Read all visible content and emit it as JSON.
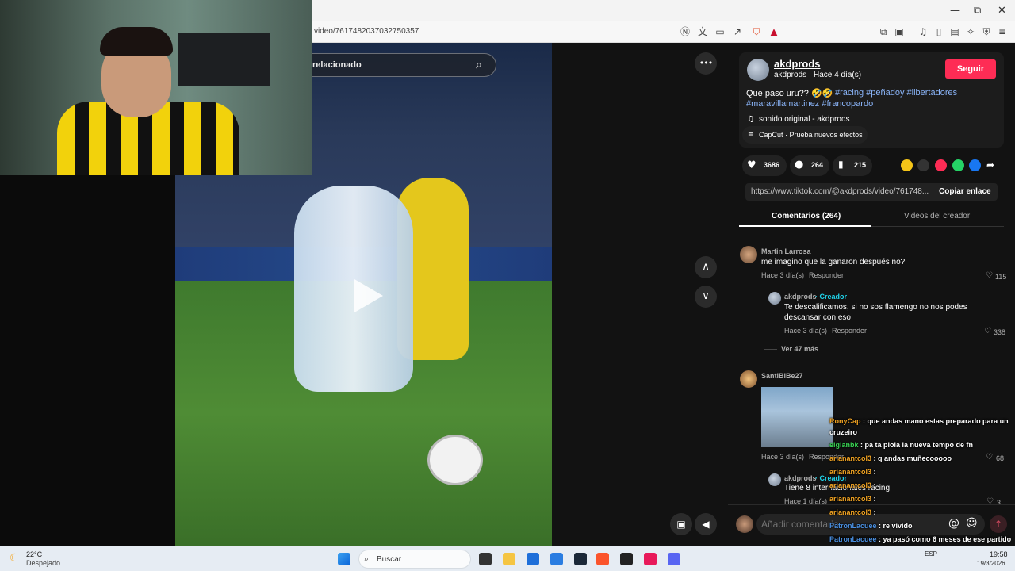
{
  "browser": {
    "url": "video/7617482037032750357",
    "window_controls": {
      "minimize": "—",
      "restore": "⧉",
      "close": "✕"
    }
  },
  "video": {
    "search_text": "relacionado",
    "more_icon": "•••"
  },
  "author": {
    "name": "akdprods",
    "meta": "akdprods · Hace 4 día(s)",
    "follow_label": "Seguir",
    "caption": "Que paso uru?? 🤣🤣",
    "hashtags_line1": "#racing #peñadoy #libertadores",
    "hashtags_line2": "#maravillamartinez #francopardo",
    "sound": "sonido original - akdprods",
    "capcut": "CapCut · Prueba nuevos efectos"
  },
  "stats": {
    "likes": "3686",
    "comments": "264",
    "saves": "215"
  },
  "share": {
    "link": "https://www.tiktok.com/@akdprods/video/761748...",
    "copy_label": "Copiar enlace"
  },
  "tabs": {
    "comments": "Comentarios (264)",
    "creator_videos": "Videos del creador"
  },
  "comments": [
    {
      "user": "Martin Larrosa",
      "text": "me imagino que la ganaron después no?",
      "time": "Hace 3 día(s)",
      "reply": "Responder",
      "likes": "115"
    },
    {
      "user": "akdprods",
      "creator_tag": "· Creador",
      "text_line1": "Te descalificamos, si no sos flamengo no nos podes",
      "text_line2": "descansar con eso",
      "time": "Hace 3 día(s)",
      "reply": "Responder",
      "likes": "338"
    },
    {
      "view_more": "Ver 47 más"
    },
    {
      "user": "SantiBiBe27",
      "time": "Hace 3 día(s)",
      "reply": "Responder",
      "likes": "68"
    },
    {
      "user": "akdprods",
      "creator_tag": "· Creador",
      "text": "Tiene 8 internacionales racing",
      "time": "Hace 1 día(s)",
      "likes": "3"
    }
  ],
  "chat_overlay": [
    {
      "user": "RonyCap",
      "text": ": que andas mano estas preparado para un",
      "user_color": "#f5a623"
    },
    {
      "user": "",
      "text": "cruzeiro",
      "user_color": "#ffffff"
    },
    {
      "user": "elgianbk",
      "text": ": pa ta piola la nueva tempo de fn",
      "user_color": "#39d353"
    },
    {
      "user": "arianantcol3",
      "text": ": q andas muñecooooo",
      "user_color": "#f5a623"
    },
    {
      "user": "arianantcol3",
      "text": ":",
      "user_color": "#f5a623"
    },
    {
      "user": "arianantcol3",
      "text": ":",
      "user_color": "#f5a623"
    },
    {
      "user": "arianantcol3",
      "text": ":",
      "user_color": "#f5a623"
    },
    {
      "user": "arianantcol3",
      "text": ":",
      "user_color": "#f5a623"
    },
    {
      "user": "PatronLacuee",
      "text": ": re vivido",
      "user_color": "#4a90e2"
    },
    {
      "user": "PatronLacuee",
      "text": ": ya pasó como 6 meses de ese partido",
      "user_color": "#4a90e2"
    }
  ],
  "comment_input": {
    "placeholder": "Añadir comentario..."
  },
  "taskbar": {
    "weather_temp": "22°C",
    "weather_desc": "Despejado",
    "search_label": "Buscar",
    "lang": "ESP",
    "time": "19:58",
    "date": "19/3/2026"
  },
  "colors": {
    "tiktok_red": "#fe2c55",
    "hashtag_blue": "#8ab4f8",
    "creator_tag": "#20d5ec"
  }
}
